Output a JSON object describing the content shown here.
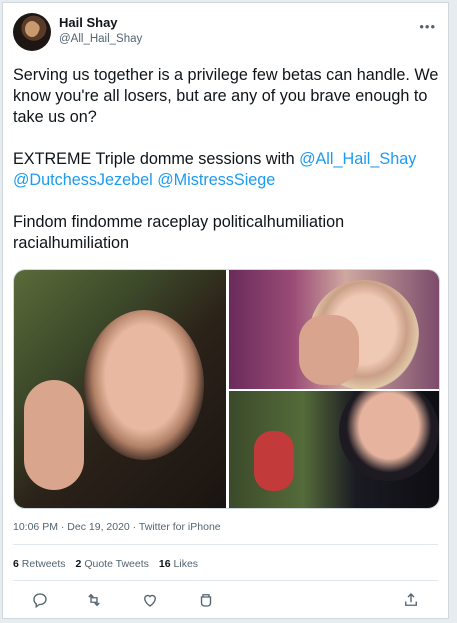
{
  "author": {
    "display_name": "Hail Shay",
    "handle": "@All_Hail_Shay"
  },
  "more_label": "•••",
  "tweet": {
    "line1": "Serving us together is a privilege few betas can handle. We know you're all losers, but are any of you brave enough to take us on?",
    "line2_prefix": "EXTREME Triple domme sessions with ",
    "mention1": "@All_Hail_Shay",
    "mention2": "@DutchessJezebel",
    "mention3": "@MistressSiege",
    "line3": "Findom findomme raceplay politicalhumiliation racialhumiliation"
  },
  "meta": {
    "time": "10:06 PM",
    "separator1": " · ",
    "date": "Dec 19, 2020",
    "separator2": " · ",
    "source": "Twitter for iPhone"
  },
  "stats": {
    "retweets_count": "6",
    "retweets_label": "Retweets",
    "quotes_count": "2",
    "quotes_label": "Quote Tweets",
    "likes_count": "16",
    "likes_label": "Likes"
  },
  "icons": {
    "reply": "reply-icon",
    "retweet": "retweet-icon",
    "like": "heart-icon",
    "tip": "tip-jar-icon",
    "share": "share-icon"
  },
  "colors": {
    "accent": "#1d9bf0",
    "text": "#0f1419",
    "secondary": "#536471"
  }
}
